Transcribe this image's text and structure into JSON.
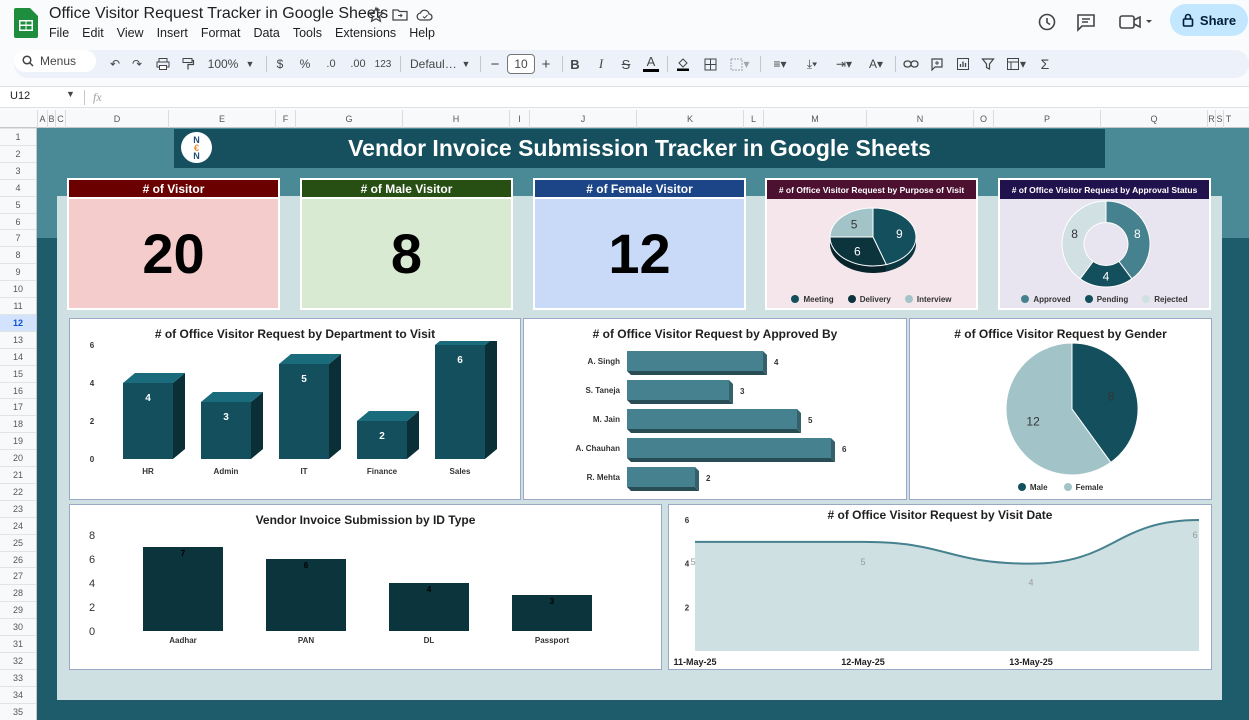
{
  "app": {
    "doc_title": "Office Visitor Request Tracker in Google Sheets",
    "menu": [
      "File",
      "Edit",
      "View",
      "Insert",
      "Format",
      "Data",
      "Tools",
      "Extensions",
      "Help"
    ],
    "share_label": "Share"
  },
  "toolbar": {
    "search_label": "Menus",
    "zoom": "100%",
    "currency": "$",
    "percent": "%",
    "dec_decrease": ".0",
    "dec_increase": ".00",
    "number_format": "123",
    "font": "Defaul…",
    "font_size": "10"
  },
  "formula_bar": {
    "cell_ref": "U12",
    "fx": "fx",
    "value": ""
  },
  "columns": [
    "A",
    "B",
    "C",
    "D",
    "E",
    "F",
    "G",
    "H",
    "I",
    "J",
    "K",
    "L",
    "M",
    "N",
    "O",
    "P",
    "Q",
    "R",
    "S",
    "T"
  ],
  "rows": [
    "1",
    "2",
    "3",
    "4",
    "5",
    "6",
    "7",
    "8",
    "9",
    "10",
    "11",
    "12",
    "13",
    "14",
    "15",
    "16",
    "17",
    "18",
    "19",
    "20",
    "21",
    "22",
    "23",
    "24",
    "25",
    "26",
    "27",
    "28",
    "29",
    "30",
    "31",
    "32",
    "33",
    "34",
    "35"
  ],
  "selected_row": "12",
  "dashboard": {
    "title": "Vendor Invoice Submission Tracker in Google Sheets",
    "logo_text": [
      "N",
      "€",
      "N"
    ],
    "kpis": [
      {
        "label": "# of Visitor",
        "value": "20",
        "header_color": "#6b0000",
        "body_color": "#f4cccc"
      },
      {
        "label": "# of Male Visitor",
        "value": "8",
        "header_color": "#274e13",
        "body_color": "#d9ead3"
      },
      {
        "label": "# of Female Visitor",
        "value": "12",
        "header_color": "#1c4587",
        "body_color": "#c9daf8"
      }
    ],
    "purpose_chart": {
      "title": "# of Office Visitor Request by Purpose of Visit",
      "header_color": "#4c1130",
      "body_color": "#f4e6ea"
    },
    "approval_chart": {
      "title": "# of Office Visitor Request by Approval Status",
      "header_color": "#20124d",
      "body_color": "#e8e4f0"
    },
    "dept_chart_title": "# of Office Visitor Request by Department to Visit",
    "approver_chart_title": "# of Office Visitor Request by Approved By",
    "gender_chart_title": "# of Office Visitor Request by Gender",
    "idtype_chart_title": "Vendor Invoice Submission by ID Type",
    "visitdate_chart_title": "# of Office Visitor Request by Visit Date"
  },
  "chart_data": [
    {
      "id": "purpose",
      "type": "pie",
      "title": "# of Office Visitor Request by Purpose of Visit",
      "categories": [
        "Meeting",
        "Delivery",
        "Interview"
      ],
      "values": [
        9,
        6,
        5
      ],
      "colors": [
        "#134f5c",
        "#0c343d",
        "#a2c4c9"
      ],
      "legend": "bottom"
    },
    {
      "id": "approval",
      "type": "pie",
      "title": "# of Office Visitor Request by Approval Status",
      "categories": [
        "Approved",
        "Pending",
        "Rejected"
      ],
      "values": [
        8,
        4,
        8
      ],
      "colors": [
        "#45818e",
        "#134f5c",
        "#d0e0e3"
      ],
      "legend": "bottom"
    },
    {
      "id": "dept",
      "type": "bar",
      "title": "# of Office Visitor Request by Department to Visit",
      "categories": [
        "HR",
        "Admin",
        "IT",
        "Finance",
        "Sales"
      ],
      "values": [
        4,
        3,
        5,
        2,
        6
      ],
      "ylim": [
        0,
        6
      ],
      "yticks": [
        "0",
        "2",
        "4",
        "6"
      ],
      "color": "#134f5c"
    },
    {
      "id": "approver",
      "type": "bar",
      "orientation": "horizontal",
      "title": "# of Office Visitor Request by Approved By",
      "categories": [
        "A. Singh",
        "S. Taneja",
        "M. Jain",
        "A. Chauhan",
        "R. Mehta"
      ],
      "values": [
        4,
        3,
        5,
        6,
        2
      ],
      "color": "#45818e"
    },
    {
      "id": "gender",
      "type": "pie",
      "title": "# of Office Visitor Request by Gender",
      "categories": [
        "Male",
        "Female"
      ],
      "values": [
        8,
        12
      ],
      "colors": [
        "#134f5c",
        "#a2c4c9"
      ],
      "legend": "bottom"
    },
    {
      "id": "idtype",
      "type": "bar",
      "title": "Vendor Invoice Submission by ID Type",
      "categories": [
        "Aadhar",
        "PAN",
        "DL",
        "Passport"
      ],
      "values": [
        7,
        6,
        4,
        3
      ],
      "ylim": [
        0,
        8
      ],
      "yticks": [
        "0",
        "2",
        "4",
        "6",
        "8"
      ],
      "color": "#0c343d"
    },
    {
      "id": "visitdate",
      "type": "area",
      "title": "# of Office Visitor Request by Visit Date",
      "x": [
        "11-May-25",
        "12-May-25",
        "13-May-25"
      ],
      "points": [
        {
          "x": "11-May-25",
          "y": 5
        },
        {
          "x": "12-May-25",
          "y": 5
        },
        {
          "x": "13-May-25",
          "y": 4
        },
        {
          "x": "",
          "y": 6
        }
      ],
      "ylim": [
        0,
        6
      ],
      "yticks": [
        "2",
        "4",
        "6"
      ],
      "color": "#45818e",
      "fill": "#cfe0e2"
    }
  ]
}
